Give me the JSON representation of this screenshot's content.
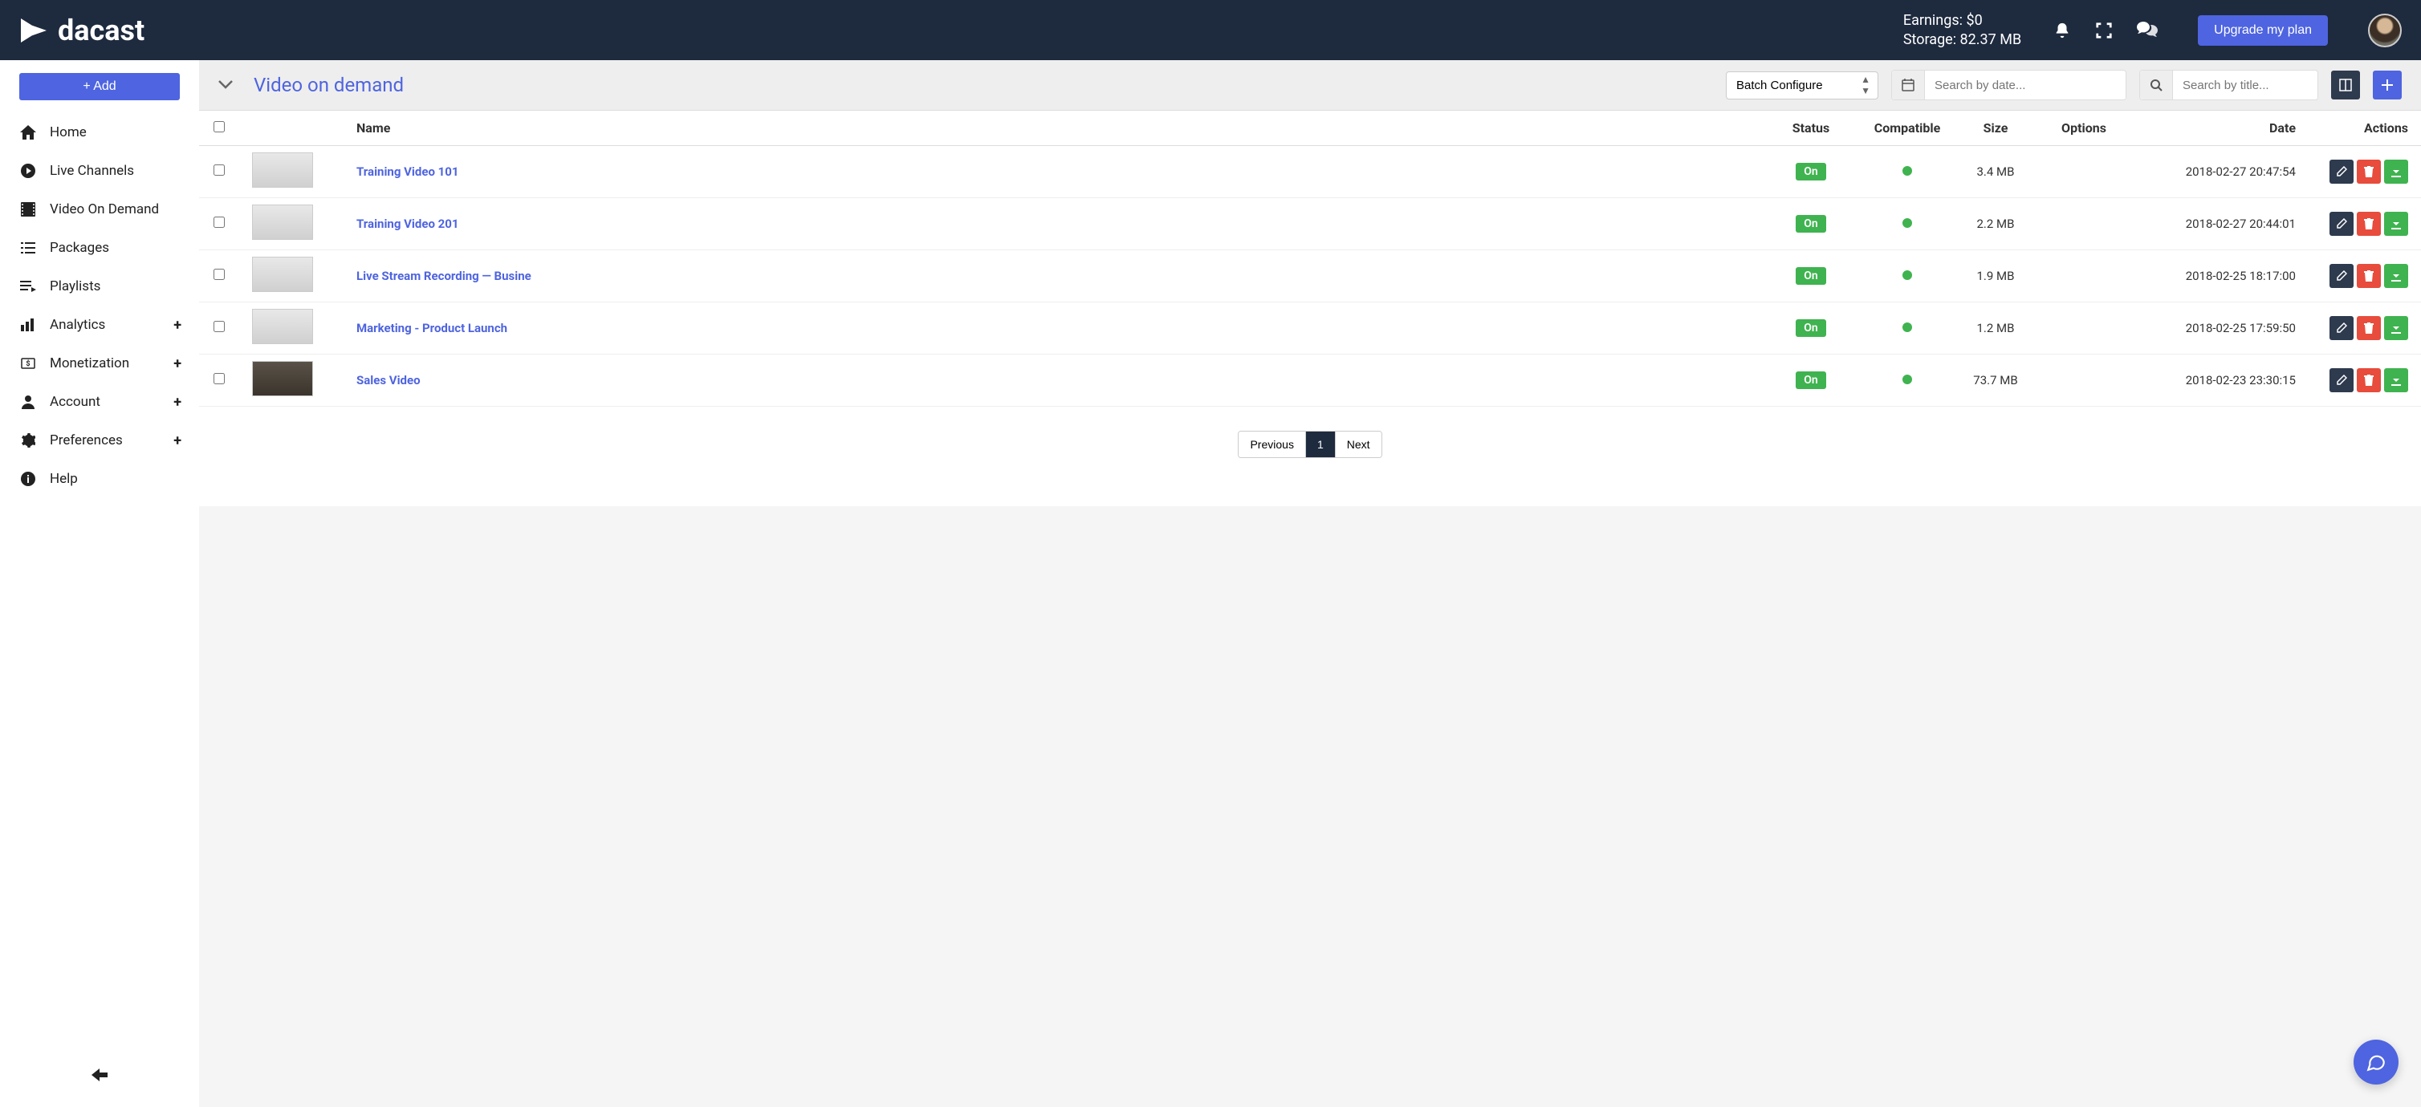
{
  "header": {
    "brand": "dacast",
    "earnings_label": "Earnings:",
    "earnings_value": "$0",
    "storage_label": "Storage:",
    "storage_value": "82.37 MB",
    "upgrade_label": "Upgrade my plan"
  },
  "sidebar": {
    "add_label": "+ Add",
    "items": [
      {
        "label": "Home",
        "icon": "home"
      },
      {
        "label": "Live Channels",
        "icon": "play-circle"
      },
      {
        "label": "Video On Demand",
        "icon": "film"
      },
      {
        "label": "Packages",
        "icon": "list"
      },
      {
        "label": "Playlists",
        "icon": "playlist"
      },
      {
        "label": "Analytics",
        "icon": "bar-chart",
        "expandable": true
      },
      {
        "label": "Monetization",
        "icon": "dollar",
        "expandable": true
      },
      {
        "label": "Account",
        "icon": "user",
        "expandable": true
      },
      {
        "label": "Preferences",
        "icon": "gear",
        "expandable": true
      },
      {
        "label": "Help",
        "icon": "info"
      }
    ]
  },
  "toolbar": {
    "page_title": "Video on demand",
    "batch_select": "Batch Configure",
    "search_date_placeholder": "Search by date...",
    "search_title_placeholder": "Search by title..."
  },
  "table": {
    "headers": {
      "name": "Name",
      "status": "Status",
      "compatible": "Compatible",
      "size": "Size",
      "options": "Options",
      "date": "Date",
      "actions": "Actions"
    },
    "rows": [
      {
        "name": "Training Video 101",
        "status": "On",
        "compatible": true,
        "size": "3.4 MB",
        "date": "2018-02-27 20:47:54"
      },
      {
        "name": "Training Video 201",
        "status": "On",
        "compatible": true,
        "size": "2.2 MB",
        "date": "2018-02-27 20:44:01"
      },
      {
        "name": "Live Stream Recording — Busine",
        "status": "On",
        "compatible": true,
        "size": "1.9 MB",
        "date": "2018-02-25 18:17:00"
      },
      {
        "name": "Marketing - Product Launch",
        "status": "On",
        "compatible": true,
        "size": "1.2 MB",
        "date": "2018-02-25 17:59:50"
      },
      {
        "name": "Sales Video",
        "status": "On",
        "compatible": true,
        "size": "73.7 MB",
        "date": "2018-02-23 23:30:15",
        "thumb_dark": true
      }
    ]
  },
  "pagination": {
    "prev": "Previous",
    "current": "1",
    "next": "Next"
  }
}
